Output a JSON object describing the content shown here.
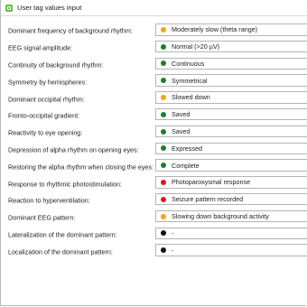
{
  "window": {
    "title": "User tag values input"
  },
  "colors": {
    "orange": "#f2a516",
    "green": "#1e7e2e",
    "red": "#e01818",
    "black": "#111111"
  },
  "fields": [
    {
      "label": "Dominant frequency of background rhythm:",
      "value": "Moderately slow (theta range)",
      "status": "orange"
    },
    {
      "label": "EEG signal amplitude:",
      "value": "Normal (>20 µV)",
      "status": "green"
    },
    {
      "label": "Continuity of background rhythm:",
      "value": "Continuous",
      "status": "green"
    },
    {
      "label": "Symmetry by hemispheres:",
      "value": "Symmetrical",
      "status": "green"
    },
    {
      "label": "Dominant occipital rhythm:",
      "value": "Slowed down",
      "status": "orange"
    },
    {
      "label": "Fronto-occipital gradient:",
      "value": "Saved",
      "status": "green"
    },
    {
      "label": "Reactivity to eye opening:",
      "value": "Saved",
      "status": "green"
    },
    {
      "label": "Depression of alpha rhythm on opening eyes:",
      "value": "Expressed",
      "status": "green"
    },
    {
      "label": "Restoring the alpha rhythm when closing the eyes:",
      "value": "Complete",
      "status": "green"
    },
    {
      "label": "Response to rhythmic photostimulation:",
      "value": "Photoparoxysmal response",
      "status": "red"
    },
    {
      "label": "Reaction to hyperventilation:",
      "value": "Seizure pattern recorded",
      "status": "red"
    },
    {
      "label": "Dominant EEG pattern:",
      "value": "Slowing down background activity",
      "status": "orange"
    },
    {
      "label": "Lateralization of the dominant pattern:",
      "value": "-",
      "status": "black"
    },
    {
      "label": "Localization of the dominant pattern:",
      "value": "-",
      "status": "black"
    }
  ]
}
